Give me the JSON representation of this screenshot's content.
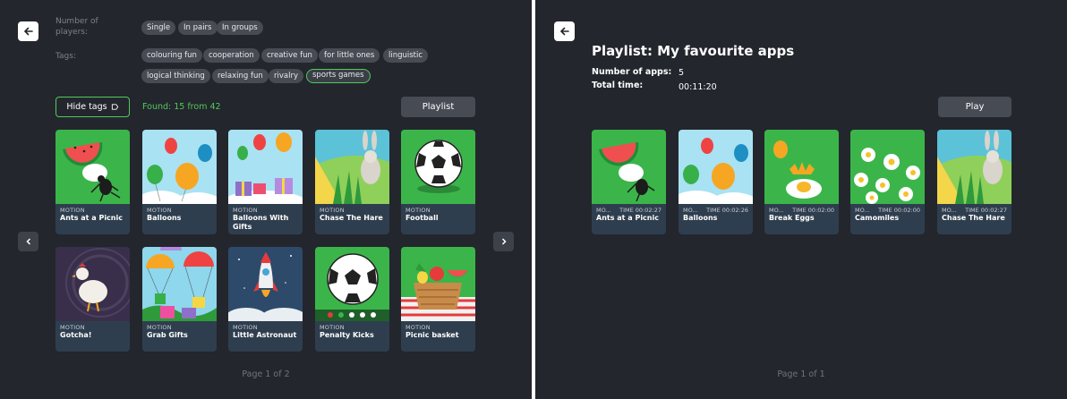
{
  "left": {
    "players_label": "Number of players:",
    "tags_label": "Tags:",
    "players": [
      "Single",
      "In pairs",
      "In groups"
    ],
    "tags": [
      "colouring fun",
      "cooperation",
      "creative fun",
      "for little ones",
      "linguistic",
      "logical thinking",
      "relaxing fun",
      "rivalry",
      "sports games"
    ],
    "selected_tag": "sports games",
    "hide_tags_label": "Hide tags",
    "found_text": "Found: 15 from 42",
    "playlist_label": "Playlist",
    "cards": [
      {
        "category": "MOTION",
        "title": "Ants at a Picnic",
        "icon": "watermelon-ant-icon"
      },
      {
        "category": "MOTION",
        "title": "Balloons",
        "icon": "balloons-icon"
      },
      {
        "category": "MOTION",
        "title": "Balloons With Gifts",
        "icon": "balloons-gifts-icon"
      },
      {
        "category": "MOTION",
        "title": "Chase The Hare",
        "icon": "hare-icon"
      },
      {
        "category": "MOTION",
        "title": "Football",
        "icon": "football-icon"
      },
      {
        "category": "MOTION",
        "title": "Gotcha!",
        "icon": "chicken-icon"
      },
      {
        "category": "MOTION",
        "title": "Grab Gifts",
        "icon": "parachute-gifts-icon"
      },
      {
        "category": "MOTION",
        "title": "Little Astronaut",
        "icon": "rocket-icon"
      },
      {
        "category": "MOTION",
        "title": "Penalty Kicks",
        "icon": "penalty-ball-icon"
      },
      {
        "category": "MOTION",
        "title": "Picnic basket",
        "icon": "picnic-basket-icon"
      }
    ],
    "page_text": "Page 1 of 2",
    "accent": "#52c95a"
  },
  "right": {
    "title": "Playlist: My favourite apps",
    "apps_label": "Number of apps:",
    "apps_value": "5",
    "time_label": "Total time:",
    "time_value": "00:11:20",
    "play_label": "Play",
    "cards": [
      {
        "category": "MO...",
        "time": "TIME 00:02:27",
        "title": "Ants at a Picnic",
        "icon": "watermelon-ant-icon"
      },
      {
        "category": "MO...",
        "time": "TIME 00:02:26",
        "title": "Balloons",
        "icon": "balloons-icon"
      },
      {
        "category": "MO...",
        "time": "TIME 00:02:00",
        "title": "Break Eggs",
        "icon": "eggs-icon"
      },
      {
        "category": "MO...",
        "time": "TIME 00:02:00",
        "title": "Camomiles",
        "icon": "camomiles-icon"
      },
      {
        "category": "MO...",
        "time": "TIME 00:02:27",
        "title": "Chase The Hare",
        "icon": "hare-icon"
      }
    ],
    "page_text": "Page 1 of 1"
  }
}
